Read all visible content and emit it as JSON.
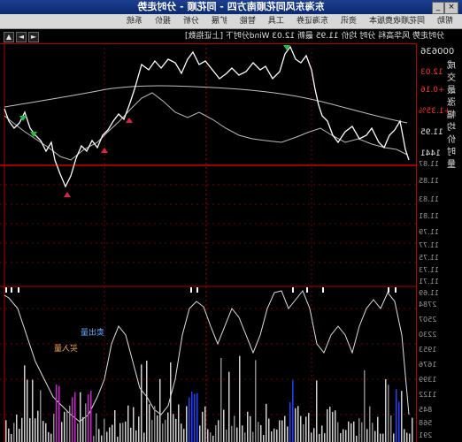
{
  "window": {
    "title": "东海东风同花顺南方四 - 同花顺 - 分时走势",
    "buttons": [
      "_",
      "□",
      "×"
    ]
  },
  "menu": {
    "items": [
      "系统",
      "报价",
      "分析",
      "扩展",
      "智能",
      "工具",
      "东海证券",
      "资讯",
      "同花顺收费版本",
      "帮助"
    ]
  },
  "infobar": {
    "text": "分时走势  风华高科 分时  均价 11.95  最新 12.03  Wind分时下 [上证指数]"
  },
  "rightpanel": {
    "code": "000636",
    "labels": [
      "成",
      "交",
      "最",
      "涨",
      "幅",
      "均",
      "价",
      "时",
      "量"
    ],
    "values": {
      "price": "12.03",
      "change": "+0.16",
      "pct": "+1.35%",
      "avg": "11.95",
      "vol": "1441"
    }
  },
  "price_scale": [
    "11.87",
    "11.85",
    "11.83",
    "11.81",
    "11.79",
    "11.77",
    "11.75",
    "11.73",
    "11.71",
    "11.69"
  ],
  "volume_scale": [
    "2784",
    "2507",
    "2230",
    "1953",
    "1676",
    "1399",
    "1122",
    "845",
    "568",
    "291"
  ],
  "annotations": {
    "buy_label": "买入量",
    "sell_label": "卖出量"
  },
  "colors": {
    "accent_red": "#b00000",
    "price_line": "#ffffff",
    "avg_line": "#bbbbbb",
    "buy_arrow": "#e02040",
    "sell_arrow": "#20c040",
    "vol_magenta": "#d020d0",
    "vol_blue": "#2040ff"
  }
}
